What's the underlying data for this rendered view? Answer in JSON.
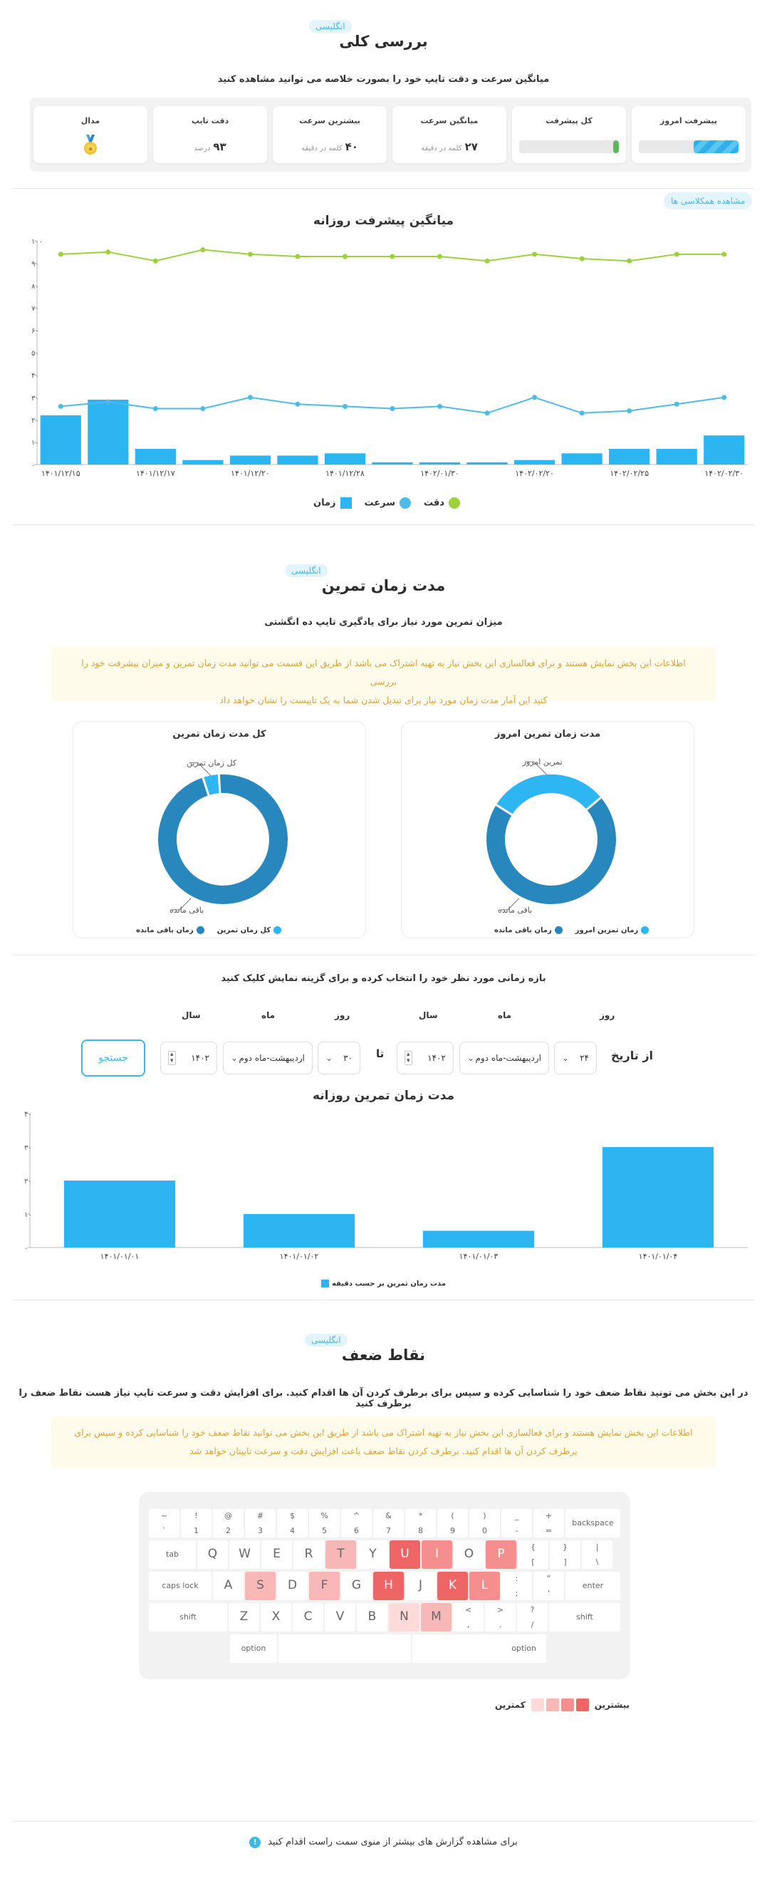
{
  "overview": {
    "badge": "انگلیسی",
    "title": "بررسی کلی",
    "subtitle": "میانگین سرعت و دقت تایپ خود را بصورت خلاصه می توانید مشاهده کنید",
    "cards": {
      "today_progress": {
        "label": "پیشرفت امروز",
        "value_fraction": 0.45,
        "color": "#35b6ee"
      },
      "total_progress": {
        "label": "کل پیشرفت",
        "value_fraction": 0.06,
        "color": "#5cb85c"
      },
      "avg_speed": {
        "label": "میانگین سرعت",
        "value": "۲۷",
        "unit": "کلمه در دقیقه"
      },
      "max_speed": {
        "label": "بیشترین سرعت",
        "value": "۴۰",
        "unit": "کلمه در دقیقه"
      },
      "accuracy": {
        "label": "دقت تایپ",
        "value": "۹۳",
        "unit": "درصد"
      },
      "medal": {
        "label": "مدال",
        "icon": "medal-icon"
      }
    },
    "see_classmates": "مشاهده همکلاسی ها"
  },
  "daily_progress": {
    "title": "میانگین پیشرفت روزانه",
    "legend": {
      "accuracy": "دقت",
      "speed": "سرعت",
      "time": "زمان"
    },
    "colors": {
      "accuracy": "#9bd13a",
      "speed": "#4dbbe6",
      "time": "#2cb5f0"
    }
  },
  "practice_time": {
    "badge": "انگلیسی",
    "title": "مدت زمان تمرین",
    "subtitle": "میزان تمرین مورد نیاز برای یادگیری تایپ ده انگشتی",
    "info_line1": "اطلاعات این بخش نمایش هستند و برای فعالسازی این بخش نیاز به تهیه اشتراک می باشد از طریق این قسمت می توانید مدت زمان تمرین و میزان پیشرفت خود را بررسی",
    "info_line2": "کنید این آمار مدت زمان مورد نیاز برای تبدیل شدن شما به یک تایپست را نشان خواهد داد",
    "today_card": {
      "title": "مدت زمان تمرین امروز",
      "label_today": "تمرین امروز",
      "label_remaining": "باقی مانده",
      "legend_remaining": "زمان باقی مانده",
      "legend_today": "زمان تمرین امروز",
      "today_fraction": 0.3
    },
    "total_card": {
      "title": "کل مدت زمان تمرین",
      "label_total": "کل زمان تمرین",
      "label_remaining": "باقی مانده",
      "legend_remaining": "زمان باقی مانده",
      "legend_total": "کل زمان تمرین",
      "total_fraction": 0.04
    }
  },
  "range": {
    "instruction": "بازه زمانی مورد نظر خود را انتخاب کرده و برای گزینه نمایش کلیک کنید",
    "from_label": "از تاریخ",
    "to_label": "تا",
    "day_label": "روز",
    "month_label": "ماه",
    "year_label": "سال",
    "from_day": "۲۴",
    "from_month": "اردیبهشت-ماه دوم",
    "from_year": "۱۴۰۲",
    "to_day": "۳۰",
    "to_month": "اردیبهشت-ماه دوم",
    "to_year": "۱۴۰۲",
    "search": "جستجو"
  },
  "daily_time": {
    "title": "مدت زمان تمرین روزانه",
    "legend": "مدت زمان تمرین بر حسب دقیقه"
  },
  "weak_points": {
    "badge": "انگلیسی",
    "title": "نقاط ضعف",
    "subtitle": "در این بخش می تونید نقاط ضعف خود را شناسایی کرده و سپس برای برطرف کردن آن ها اقدام کنید. برای افزایش دقت و سرعت تایپ نیاز هست نقاط ضعف را برطرف کنید",
    "info_line1": "اطلاعات این بخش نمایش هستند و برای فعالسازی این بخش نیاز به تهیه اشتراک می باشد از طریق این بخش می توانید نقاط ضعف خود را شناسایی کرده و سپس برای",
    "info_line2": "برطرف کردن آن ها اقدام کنید. برطرف کردن نقاط ضعف باعث افزایش دقت و سرعت تایپتان خواهد شد",
    "heat_most": "بیشترین",
    "heat_least": "کمترین",
    "heat_colors": [
      "#ffdada",
      "#f9b8b8",
      "#f58f8f",
      "#ee6565"
    ],
    "keyboard": {
      "row1": [
        {
          "top": "~",
          "bottom": "`"
        },
        {
          "top": "!",
          "bottom": "1"
        },
        {
          "top": "@",
          "bottom": "2"
        },
        {
          "top": "#",
          "bottom": "3"
        },
        {
          "top": "$",
          "bottom": "4"
        },
        {
          "top": "%",
          "bottom": "5"
        },
        {
          "top": "^",
          "bottom": "6"
        },
        {
          "top": "&",
          "bottom": "7"
        },
        {
          "top": "*",
          "bottom": "8"
        },
        {
          "top": "(",
          "bottom": "9"
        },
        {
          "top": ")",
          "bottom": "0"
        },
        {
          "top": "_",
          "bottom": "-"
        },
        {
          "top": "+",
          "bottom": "="
        }
      ],
      "backspace": "backspace",
      "tab": "tab",
      "row2": [
        {
          "char": "Q",
          "heat": 0
        },
        {
          "char": "W",
          "heat": 0
        },
        {
          "char": "E",
          "heat": 0
        },
        {
          "char": "R",
          "heat": 0
        },
        {
          "char": "T",
          "heat": 2
        },
        {
          "char": "Y",
          "heat": 0
        },
        {
          "char": "U",
          "heat": 4
        },
        {
          "char": "I",
          "heat": 3
        },
        {
          "char": "O",
          "heat": 0
        },
        {
          "char": "P",
          "heat": 3
        }
      ],
      "row2_sym": [
        {
          "top": "{",
          "bottom": "["
        },
        {
          "top": "}",
          "bottom": "]"
        },
        {
          "top": "|",
          "bottom": "\\"
        }
      ],
      "caps": "caps lock",
      "row3": [
        {
          "char": "A",
          "heat": 0
        },
        {
          "char": "S",
          "heat": 2
        },
        {
          "char": "D",
          "heat": 0
        },
        {
          "char": "F",
          "heat": 2
        },
        {
          "char": "G",
          "heat": 0
        },
        {
          "char": "H",
          "heat": 4
        },
        {
          "char": "J",
          "heat": 0
        },
        {
          "char": "K",
          "heat": 4
        },
        {
          "char": "L",
          "heat": 3
        }
      ],
      "row3_sym": [
        {
          "top": ":",
          "bottom": ";"
        },
        {
          "top": "\"",
          "bottom": "'"
        }
      ],
      "enter": "enter",
      "shift": "shift",
      "row4": [
        {
          "char": "Z",
          "heat": 0
        },
        {
          "char": "X",
          "heat": 0
        },
        {
          "char": "C",
          "heat": 0
        },
        {
          "char": "V",
          "heat": 0
        },
        {
          "char": "B",
          "heat": 0
        },
        {
          "char": "N",
          "heat": 1
        },
        {
          "char": "M",
          "heat": 2
        }
      ],
      "row4_sym": [
        {
          "top": "<",
          "bottom": ","
        },
        {
          "top": ">",
          "bottom": "."
        },
        {
          "top": "?",
          "bottom": "/"
        }
      ],
      "option": "option"
    }
  },
  "footer": {
    "text": "برای مشاهده گزارش های بیشتر از منوی سمت راست اقدام کنید",
    "icon": "info-icon"
  },
  "chart_data": [
    {
      "type": "bar",
      "title": "میانگین پیشرفت روزانه",
      "ylim": [
        0,
        100
      ],
      "yticks": [
        "۰",
        "۱۰",
        "۲۰",
        "۳۰",
        "۴۰",
        "۵۰",
        "۶۰",
        "۷۰",
        "۸۰",
        "۹۰",
        "۱۰۰"
      ],
      "xtick_labels": [
        "۱۴۰۱/۱۲/۱۵",
        "۱۴۰۱/۱۲/۱۷",
        "۱۴۰۱/۱۲/۲۰",
        "۱۴۰۱/۱۲/۲۸",
        "۱۴۰۲/۰۱/۳۰",
        "۱۴۰۲/۰۲/۲۰",
        "۱۴۰۲/۰۲/۲۵",
        "۱۴۰۲/۰۲/۳۰"
      ],
      "series": [
        {
          "name": "زمان",
          "kind": "bar",
          "values": [
            22,
            29,
            7,
            2,
            4,
            4,
            5,
            1,
            1,
            1,
            2,
            5,
            7,
            7,
            13
          ]
        },
        {
          "name": "سرعت",
          "kind": "line",
          "values": [
            26,
            28,
            25,
            25,
            30,
            27,
            26,
            25,
            26,
            23,
            30,
            23,
            24,
            27,
            30
          ]
        },
        {
          "name": "دقت",
          "kind": "line",
          "values": [
            94,
            95,
            91,
            96,
            94,
            93,
            93,
            93,
            93,
            91,
            94,
            92,
            91,
            94,
            94
          ]
        }
      ],
      "legend": "bottom-center"
    },
    {
      "type": "bar",
      "title": "مدت زمان تمرین روزانه",
      "categories": [
        "۱۴۰۱/۰۱/۰۱",
        "۱۴۰۱/۰۱/۰۲",
        "۱۴۰۱/۰۱/۰۳",
        "۱۴۰۱/۰۱/۰۴"
      ],
      "values": [
        20,
        10,
        5,
        30
      ],
      "yticks": [
        "۰",
        "۱۰",
        "۲۰",
        "۳۰",
        "۴۰"
      ],
      "ylim": [
        0,
        40
      ],
      "series": [
        {
          "name": "مدت زمان تمرین بر حسب دقیقه",
          "values": [
            20,
            10,
            5,
            30
          ]
        }
      ],
      "legend": "bottom-center"
    }
  ]
}
